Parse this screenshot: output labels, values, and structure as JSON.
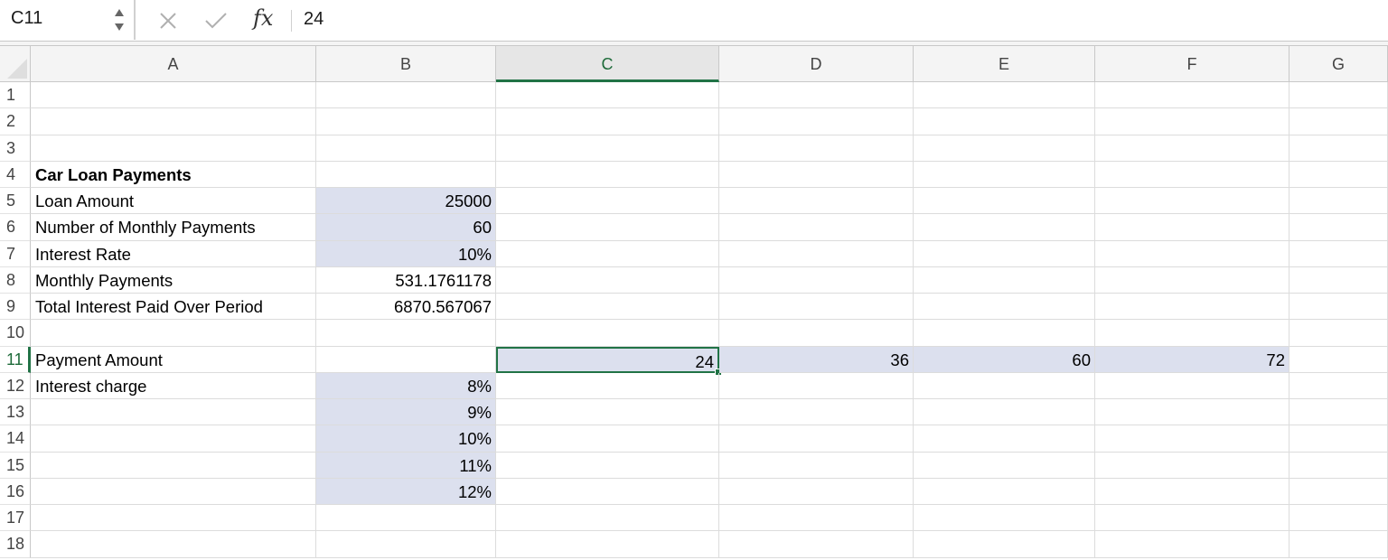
{
  "formula_bar": {
    "name_box": "C11",
    "cancel_icon": "close-icon",
    "enter_icon": "checkmark-icon",
    "fx_label": "fx",
    "formula": "24"
  },
  "columns": [
    "A",
    "B",
    "C",
    "D",
    "E",
    "F",
    "G"
  ],
  "active_column": "C",
  "rows": [
    "1",
    "2",
    "3",
    "4",
    "5",
    "6",
    "7",
    "8",
    "9",
    "10",
    "11",
    "12",
    "13",
    "14",
    "15",
    "16",
    "17",
    "18"
  ],
  "active_row": "11",
  "selected_cell": "C11",
  "fill_color": "#dce0ee",
  "accent_color": "#217346",
  "cells": {
    "A4": "Car Loan Payments",
    "A5": "Loan Amount",
    "B5": "25000",
    "A6": "Number of Monthly Payments",
    "B6": "60",
    "A7": "Interest Rate",
    "B7": "10%",
    "A8": "Monthly Payments",
    "B8": "531.1761178",
    "A9": "Total Interest Paid Over Period",
    "B9": "6870.567067",
    "A11": "Payment Amount",
    "C11": "24",
    "D11": "36",
    "E11": "60",
    "F11": "72",
    "A12": "Interest charge",
    "B12": "8%",
    "B13": "9%",
    "B14": "10%",
    "B15": "11%",
    "B16": "12%"
  }
}
